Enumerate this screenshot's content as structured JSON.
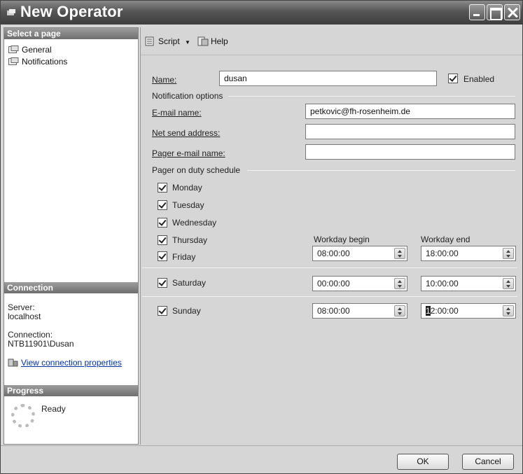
{
  "window": {
    "title": "New Operator"
  },
  "left": {
    "select_page_header": "Select a page",
    "pages": [
      {
        "label": "General",
        "icon": "page-icon"
      },
      {
        "label": "Notifications",
        "icon": "page-icon"
      }
    ],
    "connection_header": "Connection",
    "server_label": "Server:",
    "server_value": "localhost",
    "connection_label": "Connection:",
    "connection_value": "NTB11901\\Dusan",
    "view_props_link": "View connection properties",
    "progress_header": "Progress",
    "progress_status": "Ready"
  },
  "toolbar": {
    "script_label": "Script",
    "help_label": "Help"
  },
  "form": {
    "name_label": "Name:",
    "name_value": "dusan",
    "enabled_label": "Enabled",
    "enabled_checked": true,
    "notification_options_label": "Notification options",
    "email_label": "E-mail name:",
    "email_value": "petkovic@fh-rosenheim.de",
    "netsend_label": "Net send address:",
    "netsend_value": "",
    "pager_email_label": "Pager e-mail name:",
    "pager_email_value": "",
    "pager_schedule_label": "Pager on duty schedule",
    "days": [
      {
        "label": "Monday",
        "checked": true
      },
      {
        "label": "Tuesday",
        "checked": true
      },
      {
        "label": "Wednesday",
        "checked": true
      },
      {
        "label": "Thursday",
        "checked": true
      },
      {
        "label": "Friday",
        "checked": true
      }
    ],
    "workday_begin_label": "Workday begin",
    "workday_end_label": "Workday end",
    "workday_begin_value": "08:00:00",
    "workday_end_value": "18:00:00",
    "saturday": {
      "label": "Saturday",
      "checked": true,
      "begin": "00:00:00",
      "end": "10:00:00"
    },
    "sunday": {
      "label": "Sunday",
      "checked": true,
      "begin": "08:00:00",
      "end_selected": "1",
      "end_rest": "2:00:00"
    }
  },
  "footer": {
    "ok_label": "OK",
    "cancel_label": "Cancel"
  }
}
